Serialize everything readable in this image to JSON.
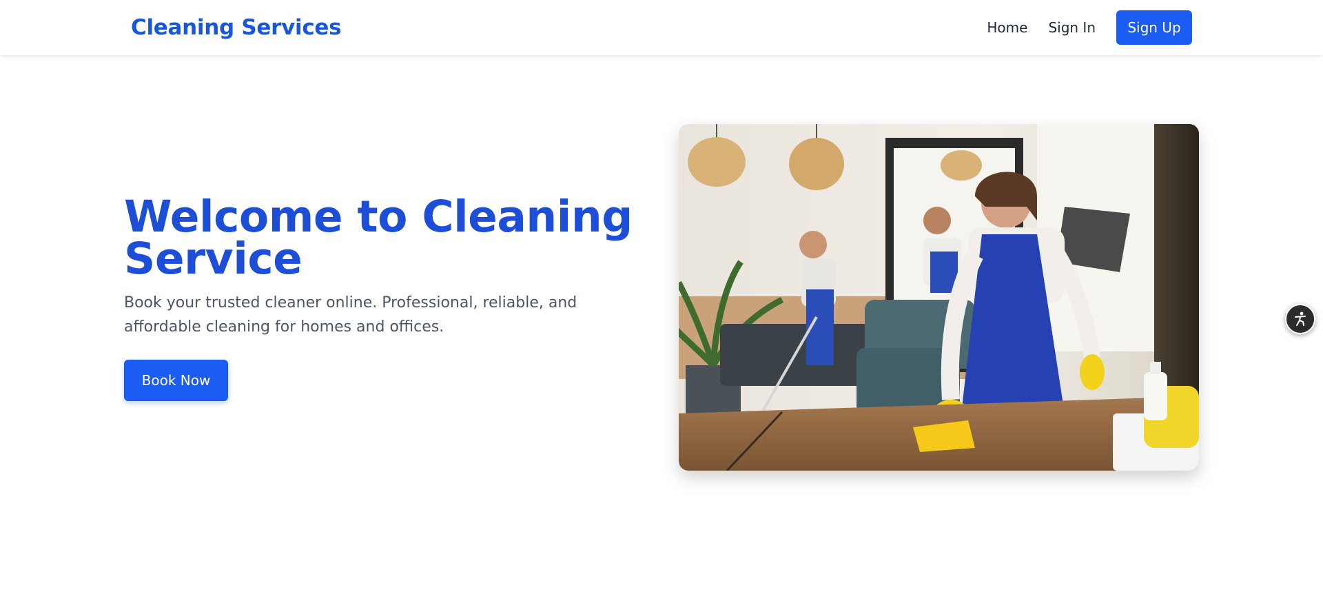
{
  "header": {
    "brand": "Cleaning Services",
    "nav": {
      "home": "Home",
      "sign_in": "Sign In",
      "sign_up": "Sign Up"
    }
  },
  "hero": {
    "title": "Welcome to Cleaning Service",
    "subtitle": "Book your trusted cleaner online. Professional, reliable, and affordable cleaning for homes and offices.",
    "cta": "Book Now",
    "image_icon": "office-cleaning-photo"
  },
  "accessibility": {
    "icon": "accessibility-icon"
  },
  "colors": {
    "brand": "#1a56db",
    "title": "#1d4ed8",
    "button": "#1b5cf2",
    "text_muted": "#4b5563"
  }
}
